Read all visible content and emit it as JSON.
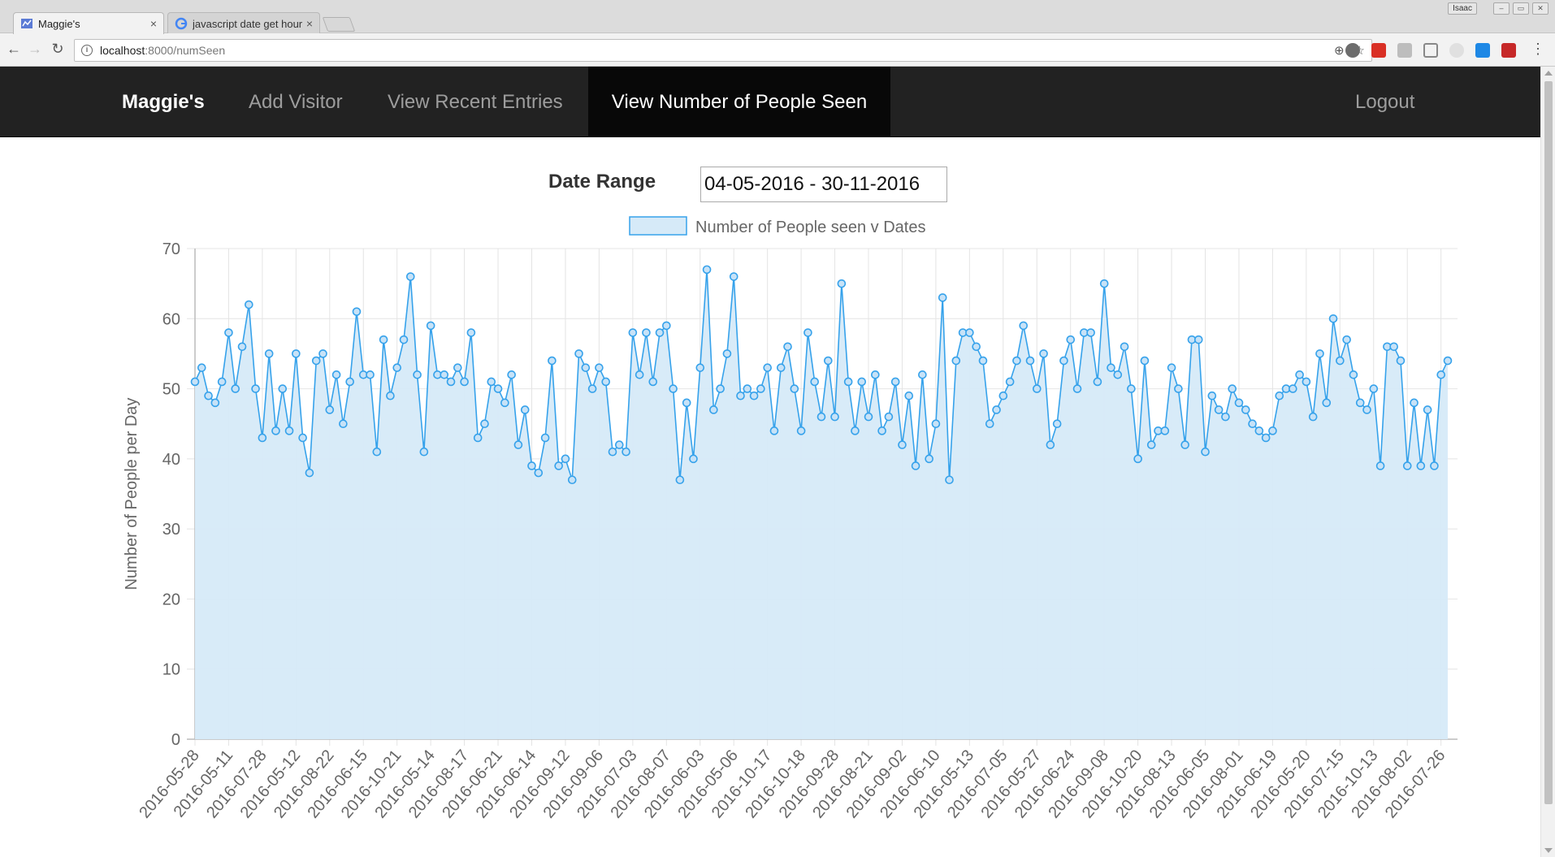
{
  "browser": {
    "tabs": [
      {
        "title": "Maggie's",
        "close": "×"
      },
      {
        "title": "javascript date get hour",
        "close": "×"
      }
    ],
    "url_host": "localhost",
    "url_rest": ":8000/numSeen",
    "user": "Isaac",
    "colors": {
      "tabstrip": "#dcdcdc",
      "toolbar": "#f2f2f2"
    }
  },
  "navbar": {
    "brand": "Maggie's",
    "items": [
      "Add Visitor",
      "View Recent Entries",
      "View Number of People Seen"
    ],
    "active": "View Number of People Seen",
    "logout": "Logout",
    "colors": {
      "background": "#222222",
      "active_bg": "#080808",
      "text": "#9d9d9d",
      "active_text": "#ffffff"
    }
  },
  "date_range": {
    "label": "Date Range",
    "value": "04-05-2016 - 30-11-2016"
  },
  "chart_data": {
    "type": "area",
    "legend": "Number of People seen v Dates",
    "legend_position": "top",
    "ylabel": "Number of People per Day",
    "xlabel": "",
    "ylim": [
      0,
      70
    ],
    "yticks": [
      0,
      10,
      20,
      30,
      40,
      50,
      60,
      70
    ],
    "grid": true,
    "line_color": "#36a2eb",
    "fill_color": "#d6eaf8",
    "x_tick_labels": [
      "2016-05-28",
      "2016-05-11",
      "2016-07-28",
      "2016-05-12",
      "2016-08-22",
      "2016-06-15",
      "2016-10-21",
      "2016-05-14",
      "2016-08-17",
      "2016-06-21",
      "2016-06-14",
      "2016-09-12",
      "2016-09-06",
      "2016-07-03",
      "2016-08-07",
      "2016-06-03",
      "2016-05-06",
      "2016-10-17",
      "2016-10-18",
      "2016-09-28",
      "2016-08-21",
      "2016-09-02",
      "2016-06-10",
      "2016-05-13",
      "2016-07-05",
      "2016-05-27",
      "2016-06-24",
      "2016-09-08",
      "2016-10-20",
      "2016-08-13",
      "2016-06-05",
      "2016-08-01",
      "2016-06-19",
      "2016-05-20",
      "2016-07-15",
      "2016-10-13",
      "2016-08-02",
      "2016-07-26"
    ],
    "values": [
      51,
      53,
      49,
      48,
      51,
      58,
      50,
      56,
      62,
      50,
      43,
      55,
      44,
      50,
      44,
      55,
      43,
      38,
      54,
      55,
      47,
      52,
      45,
      51,
      61,
      52,
      52,
      41,
      57,
      49,
      53,
      57,
      66,
      52,
      41,
      59,
      52,
      52,
      51,
      53,
      51,
      58,
      43,
      45,
      51,
      50,
      48,
      52,
      42,
      47,
      39,
      38,
      43,
      54,
      39,
      40,
      37,
      55,
      53,
      50,
      53,
      51,
      41,
      42,
      41,
      58,
      52,
      58,
      51,
      58,
      59,
      50,
      37,
      48,
      40,
      53,
      67,
      47,
      50,
      55,
      66,
      49,
      50,
      49,
      50,
      53,
      44,
      53,
      56,
      50,
      44,
      58,
      51,
      46,
      54,
      46,
      65,
      51,
      44,
      51,
      46,
      52,
      44,
      46,
      51,
      42,
      49,
      39,
      52,
      40,
      45,
      63,
      37,
      54,
      58,
      58,
      56,
      54,
      45,
      47,
      49,
      51,
      54,
      59,
      54,
      50,
      55,
      42,
      45,
      54,
      57,
      50,
      58,
      58,
      51,
      65,
      53,
      52,
      56,
      50,
      40,
      54,
      42,
      44,
      44,
      53,
      50,
      42,
      57,
      57,
      41,
      49,
      47,
      46,
      50,
      48,
      47,
      45,
      44,
      43,
      44,
      49,
      50,
      50,
      52,
      51,
      46,
      55,
      48,
      60,
      54,
      57,
      52,
      48,
      47,
      50,
      39,
      56,
      56,
      54,
      39,
      48,
      39,
      47,
      39,
      52,
      54
    ]
  }
}
